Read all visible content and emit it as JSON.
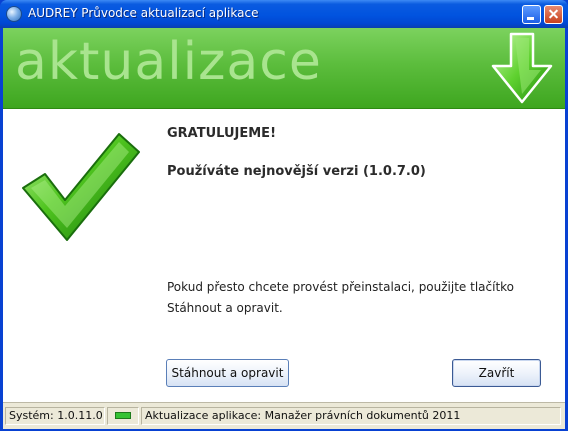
{
  "window": {
    "title": "AUDREY Průvodce aktualizací aplikace"
  },
  "banner": {
    "title": "aktualizace",
    "icon": "down-arrow-icon"
  },
  "content": {
    "heading": "GRATULUJEME!",
    "version_text": "Používáte nejnovější verzi (1.0.7.0)",
    "info_line1": "Pokud přesto chcete provést přeinstalaci, použijte tlačítko",
    "info_line2": "Stáhnout a opravit.",
    "check_icon": "checkmark-icon"
  },
  "buttons": {
    "repair_label": "Stáhnout a opravit",
    "close_label": "Zavřít"
  },
  "status": {
    "system": "Systém: 1.0.11.0",
    "message": "Aktualizace aplikace: Manažer právních dokumentů 2011",
    "indicator_color": "#35c233"
  },
  "colors": {
    "banner": "#5cbd3d",
    "titlebar": "#0153df"
  }
}
